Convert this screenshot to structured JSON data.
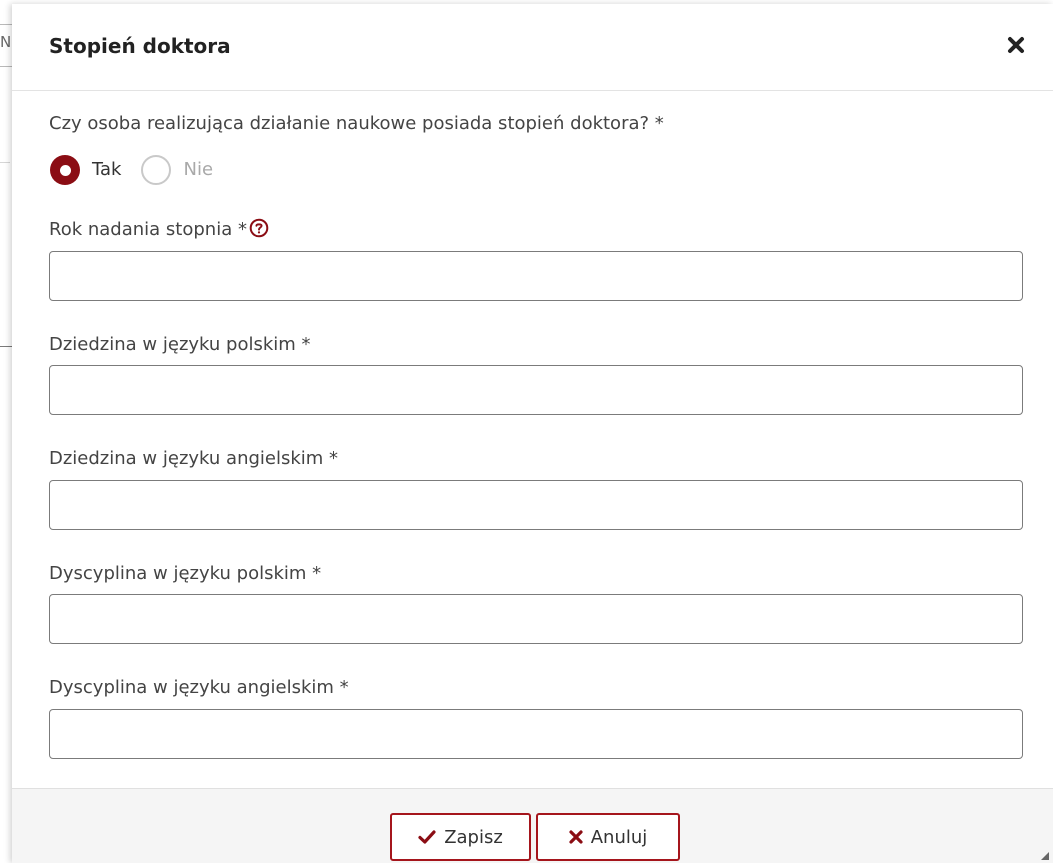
{
  "background": {
    "fragment_text": "N"
  },
  "modal": {
    "title": "Stopień doktora",
    "close_icon": "close-icon"
  },
  "question": {
    "label": "Czy osoba realizująca działanie naukowe posiada stopień doktora? *",
    "options": [
      {
        "label": "Tak",
        "selected": true
      },
      {
        "label": "Nie",
        "selected": false
      }
    ]
  },
  "fields": {
    "year": {
      "label": "Rok nadania stopnia *",
      "value": "",
      "help_icon": "question-circle-icon"
    },
    "field_pl": {
      "label": "Dziedzina w języku polskim *",
      "value": ""
    },
    "field_en": {
      "label": "Dziedzina w języku angielskim *",
      "value": ""
    },
    "discipline_pl": {
      "label": "Dyscyplina w języku polskim *",
      "value": ""
    },
    "discipline_en": {
      "label": "Dyscyplina w języku angielskim *",
      "value": ""
    }
  },
  "footer": {
    "save_label": "Zapisz",
    "cancel_label": "Anuluj",
    "save_icon": "check-icon",
    "cancel_icon": "times-icon"
  },
  "colors": {
    "accent": "#8b0d14",
    "button_border": "#a5151c"
  }
}
